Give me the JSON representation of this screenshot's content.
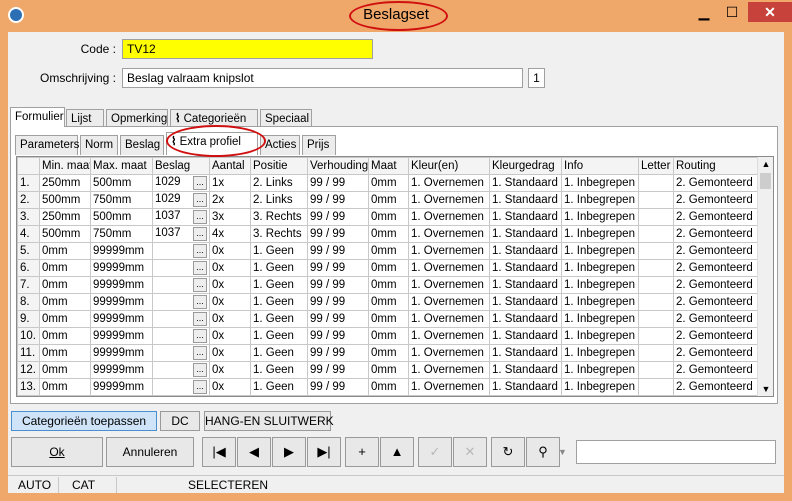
{
  "window": {
    "title": "Beslagset"
  },
  "titlebar_buttons": {
    "minimize": "▁",
    "maximize": "☐",
    "close": "✕"
  },
  "form": {
    "code_label": "Code :",
    "code_value": "TV12",
    "omschrijving_label": "Omschrijving :",
    "omschrijving_value": "Beslag valraam knipslot",
    "counter": "1"
  },
  "main_tabs": [
    {
      "label": "Formulier",
      "active": true
    },
    {
      "label": "Lijst"
    },
    {
      "label": "Opmerking"
    },
    {
      "label": "Categorieën",
      "icon": "paperclip-icon"
    },
    {
      "label": "Speciaal"
    }
  ],
  "sub_tabs": [
    {
      "label": "Parameters"
    },
    {
      "label": "Norm"
    },
    {
      "label": "Beslag"
    },
    {
      "label": "Extra profiel",
      "active": true,
      "icon": "paperclip-icon"
    },
    {
      "label": "Acties"
    },
    {
      "label": "Prijs"
    }
  ],
  "grid": {
    "columns": [
      "",
      "Min. maat",
      "Max. maat",
      "Beslag",
      "Aantal",
      "Positie",
      "Verhouding",
      "Maat",
      "Kleur(en)",
      "Kleurgedrag",
      "Info",
      "Letter",
      "Routing"
    ],
    "ellipsis": "...",
    "rows": [
      [
        "1.",
        "250mm",
        "500mm",
        "1029",
        "1x",
        "2. Links",
        "99 / 99",
        "0mm",
        "1. Overnemen",
        "1. Standaard",
        "1. Inbegrepen",
        "",
        "2. Gemonteerd"
      ],
      [
        "2.",
        "500mm",
        "750mm",
        "1029",
        "2x",
        "2. Links",
        "99 / 99",
        "0mm",
        "1. Overnemen",
        "1. Standaard",
        "1. Inbegrepen",
        "",
        "2. Gemonteerd"
      ],
      [
        "3.",
        "250mm",
        "500mm",
        "1037",
        "3x",
        "3. Rechts",
        "99 / 99",
        "0mm",
        "1. Overnemen",
        "1. Standaard",
        "1. Inbegrepen",
        "",
        "2. Gemonteerd"
      ],
      [
        "4.",
        "500mm",
        "750mm",
        "1037",
        "4x",
        "3. Rechts",
        "99 / 99",
        "0mm",
        "1. Overnemen",
        "1. Standaard",
        "1. Inbegrepen",
        "",
        "2. Gemonteerd"
      ],
      [
        "5.",
        "0mm",
        "99999mm",
        "",
        "0x",
        "1. Geen",
        "99 / 99",
        "0mm",
        "1. Overnemen",
        "1. Standaard",
        "1. Inbegrepen",
        "",
        "2. Gemonteerd"
      ],
      [
        "6.",
        "0mm",
        "99999mm",
        "",
        "0x",
        "1. Geen",
        "99 / 99",
        "0mm",
        "1. Overnemen",
        "1. Standaard",
        "1. Inbegrepen",
        "",
        "2. Gemonteerd"
      ],
      [
        "7.",
        "0mm",
        "99999mm",
        "",
        "0x",
        "1. Geen",
        "99 / 99",
        "0mm",
        "1. Overnemen",
        "1. Standaard",
        "1. Inbegrepen",
        "",
        "2. Gemonteerd"
      ],
      [
        "8.",
        "0mm",
        "99999mm",
        "",
        "0x",
        "1. Geen",
        "99 / 99",
        "0mm",
        "1. Overnemen",
        "1. Standaard",
        "1. Inbegrepen",
        "",
        "2. Gemonteerd"
      ],
      [
        "9.",
        "0mm",
        "99999mm",
        "",
        "0x",
        "1. Geen",
        "99 / 99",
        "0mm",
        "1. Overnemen",
        "1. Standaard",
        "1. Inbegrepen",
        "",
        "2. Gemonteerd"
      ],
      [
        "10.",
        "0mm",
        "99999mm",
        "",
        "0x",
        "1. Geen",
        "99 / 99",
        "0mm",
        "1. Overnemen",
        "1. Standaard",
        "1. Inbegrepen",
        "",
        "2. Gemonteerd"
      ],
      [
        "11.",
        "0mm",
        "99999mm",
        "",
        "0x",
        "1. Geen",
        "99 / 99",
        "0mm",
        "1. Overnemen",
        "1. Standaard",
        "1. Inbegrepen",
        "",
        "2. Gemonteerd"
      ],
      [
        "12.",
        "0mm",
        "99999mm",
        "",
        "0x",
        "1. Geen",
        "99 / 99",
        "0mm",
        "1. Overnemen",
        "1. Standaard",
        "1. Inbegrepen",
        "",
        "2. Gemonteerd"
      ],
      [
        "13.",
        "0mm",
        "99999mm",
        "",
        "0x",
        "1. Geen",
        "99 / 99",
        "0mm",
        "1. Overnemen",
        "1. Standaard",
        "1. Inbegrepen",
        "",
        "2. Gemonteerd"
      ]
    ]
  },
  "bottom_buttons": {
    "categories_apply": "Categorieën toepassen",
    "dc": "DC",
    "hang_sluitwerk": "HANG-EN SLUITWERK",
    "ok": "Ok",
    "annuleren": "Annuleren"
  },
  "nav_toolbar": [
    {
      "icon": "first-record-icon",
      "glyph": "|◀",
      "enabled": true
    },
    {
      "icon": "previous-record-icon",
      "glyph": "◀",
      "enabled": true
    },
    {
      "icon": "next-record-icon",
      "glyph": "▶",
      "enabled": true
    },
    {
      "icon": "last-record-icon",
      "glyph": "▶|",
      "enabled": true
    },
    {
      "icon": "add-icon",
      "glyph": "+",
      "enabled": true
    },
    {
      "icon": "up-icon",
      "glyph": "▲",
      "enabled": true
    },
    {
      "icon": "check-icon",
      "glyph": "✓",
      "enabled": false
    },
    {
      "icon": "cancel-icon",
      "glyph": "✕",
      "enabled": false
    },
    {
      "icon": "refresh-icon",
      "glyph": "↻",
      "enabled": true
    },
    {
      "icon": "binoculars-icon",
      "glyph": "⚲",
      "enabled": true
    }
  ],
  "search": {
    "value": ""
  },
  "statusbar": {
    "mode1": "AUTO",
    "mode2": "CAT",
    "mode3": "SELECTEREN"
  },
  "colors": {
    "chrome": "#f0a86a",
    "code_bg": "#ffff00",
    "highlight": "#d01010",
    "selected_button": "#cfe4f8"
  }
}
